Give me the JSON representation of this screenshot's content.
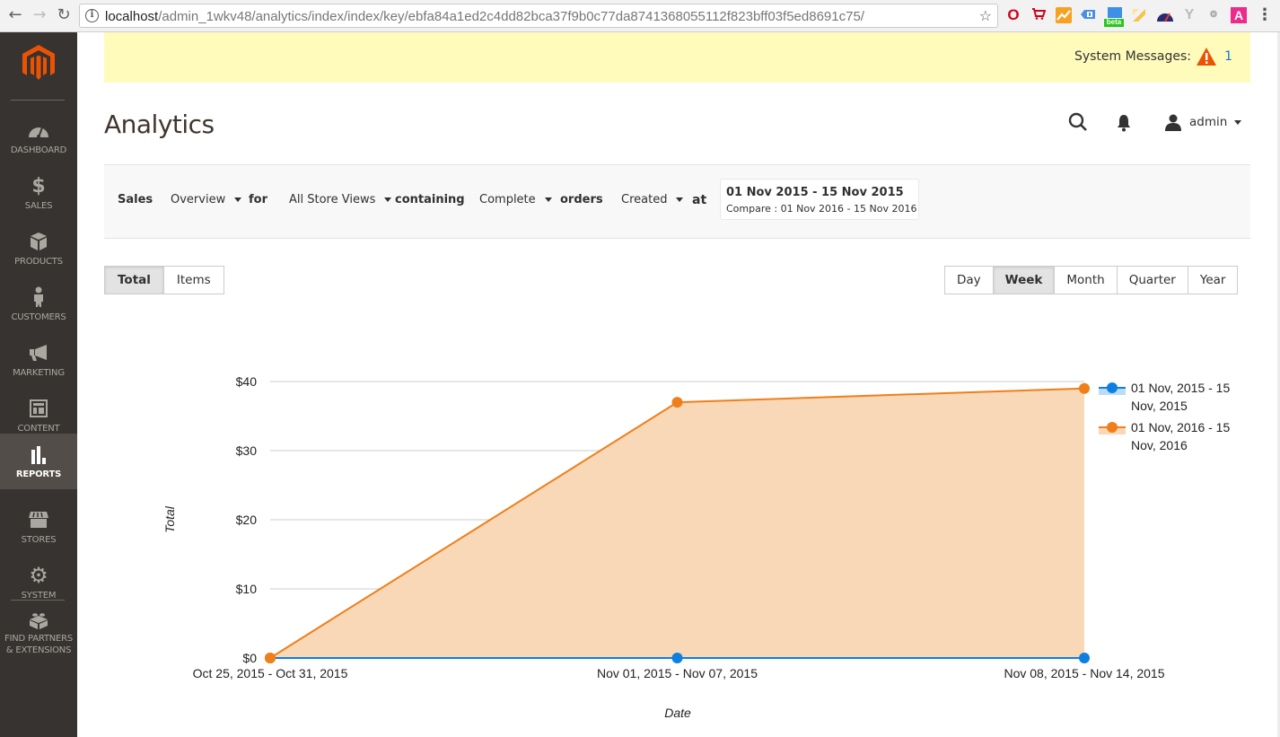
{
  "browser": {
    "url_host": "localhost",
    "url_path": "/admin_1wkv48/analytics/index/index/key/ebfa84a1ed2c4dd82bca37f9b0c77da8741368055112f823bff03f5ed8691c75/",
    "extensions": [
      "opera-icon",
      "cart-icon",
      "analytics-icon",
      "tag-icon",
      "beta-icon",
      "highlighter-icon",
      "speedometer-icon",
      "y-icon",
      "seo-icon",
      "a-icon"
    ],
    "beta_label": "beta",
    "a_label": "A"
  },
  "sidebar": {
    "items": [
      {
        "label": "DASHBOARD",
        "icon": "dashboard-icon"
      },
      {
        "label": "SALES",
        "icon": "dollar-icon"
      },
      {
        "label": "PRODUCTS",
        "icon": "box-icon"
      },
      {
        "label": "CUSTOMERS",
        "icon": "person-icon"
      },
      {
        "label": "MARKETING",
        "icon": "megaphone-icon"
      },
      {
        "label": "CONTENT",
        "icon": "layout-icon"
      },
      {
        "label": "REPORTS",
        "icon": "bar-chart-icon",
        "active": true
      },
      {
        "label": "STORES",
        "icon": "storefront-icon"
      },
      {
        "label": "SYSTEM",
        "icon": "gear-icon"
      },
      {
        "label_line1": "FIND PARTNERS",
        "label_line2": "& EXTENSIONS",
        "icon": "lego-brick-icon"
      }
    ]
  },
  "system_messages": {
    "label": "System Messages:",
    "count": "1",
    "icon": "warning-icon"
  },
  "header": {
    "title": "Analytics",
    "user": "admin"
  },
  "filters": {
    "sales_label": "Sales",
    "report_type": "Overview",
    "for_label": "for",
    "store_view": "All Store Views",
    "containing_label": "containing",
    "order_status": "Complete",
    "orders_label": "orders",
    "date_type": "Created",
    "at_label": "at",
    "date_range": "01 Nov 2015 - 15 Nov 2015",
    "compare_range": "Compare : 01 Nov 2016 - 15 Nov 2016"
  },
  "metric_tabs": [
    {
      "label": "Total",
      "active": true
    },
    {
      "label": "Items",
      "active": false
    }
  ],
  "period_tabs": [
    {
      "label": "Day",
      "active": false
    },
    {
      "label": "Week",
      "active": true
    },
    {
      "label": "Month",
      "active": false
    },
    {
      "label": "Quarter",
      "active": false
    },
    {
      "label": "Year",
      "active": false
    }
  ],
  "chart_data": {
    "type": "area",
    "title": "",
    "xlabel": "Date",
    "ylabel": "Total",
    "categories": [
      "Oct 25, 2015 - Oct 31, 2015",
      "Nov 01, 2015 - Nov 07, 2015",
      "Nov 08, 2015 - Nov 14, 2015"
    ],
    "ylim": [
      0,
      40
    ],
    "yticks": [
      0,
      10,
      20,
      30,
      40
    ],
    "ytick_labels": [
      "$0",
      "$10",
      "$20",
      "$30",
      "$40"
    ],
    "grid": true,
    "legend_position": "right",
    "series": [
      {
        "name": "01 Nov, 2015 - 15 Nov, 2015",
        "legend_line1": "01 Nov, 2015 - 15",
        "legend_line2": "Nov, 2015",
        "values": [
          0,
          0,
          0
        ],
        "color": "#0e7fe1",
        "fill": "#bcdcf6"
      },
      {
        "name": "01 Nov, 2016 - 15 Nov, 2016",
        "legend_line1": "01 Nov, 2016 - 15",
        "legend_line2": "Nov, 2016",
        "values": [
          0,
          37,
          39
        ],
        "color": "#ef7f1a",
        "fill": "#f9d8b8"
      }
    ]
  }
}
